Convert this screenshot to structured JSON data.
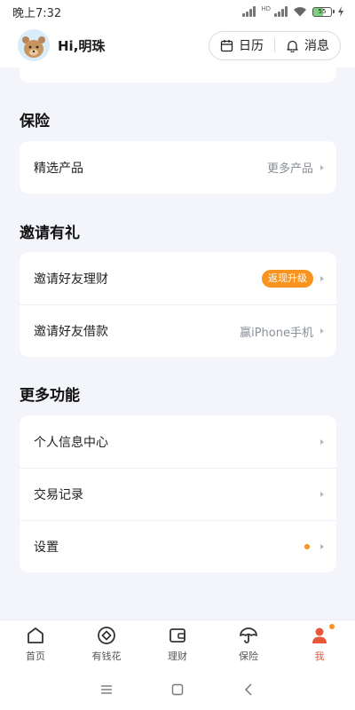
{
  "status_bar": {
    "time": "晚上7:32",
    "network_label": "HD",
    "battery_level": "55"
  },
  "header": {
    "greeting": "Hi,明珠",
    "calendar_label": "日历",
    "messages_label": "消息"
  },
  "sections": {
    "insurance": {
      "title": "保险",
      "rows": [
        {
          "label": "精选产品",
          "right_text": "更多产品"
        }
      ]
    },
    "invite": {
      "title": "邀请有礼",
      "rows": [
        {
          "label": "邀请好友理财",
          "badge": "返现升级"
        },
        {
          "label": "邀请好友借款",
          "right_text": "赢iPhone手机"
        }
      ]
    },
    "more": {
      "title": "更多功能",
      "rows": [
        {
          "label": "个人信息中心"
        },
        {
          "label": "交易记录"
        },
        {
          "label": "设置",
          "has_dot": true
        }
      ]
    }
  },
  "bottom_nav": {
    "items": [
      {
        "label": "首页",
        "icon": "home-icon"
      },
      {
        "label": "有钱花",
        "icon": "diamond-circle-icon"
      },
      {
        "label": "理财",
        "icon": "wallet-icon"
      },
      {
        "label": "保险",
        "icon": "umbrella-icon"
      },
      {
        "label": "我",
        "icon": "person-icon",
        "active": true
      }
    ]
  },
  "colors": {
    "accent": "#f7931e",
    "active_tab": "#e8573a",
    "background": "#f3f5fa"
  }
}
